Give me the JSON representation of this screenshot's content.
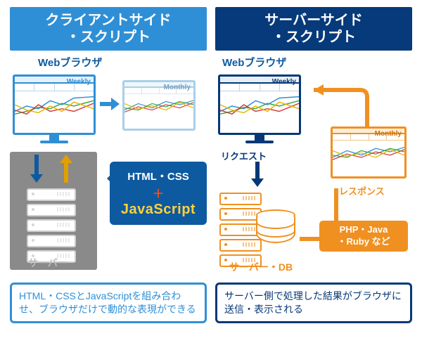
{
  "left": {
    "title_l1": "クライアントサイド",
    "title_l2": "・スクリプト",
    "browser_label": "Webブラウザ",
    "chart_left_tag": "Weekly",
    "chart_right_tag": "Monthly",
    "bubble_l1": "HTML・CSS",
    "bubble_plus": "＋",
    "bubble_js": "JavaScript",
    "server_label": "サーバー",
    "caption": "HTML・CSSとJavaScriptを組み合わせ、ブラウザだけで動的な表現ができる",
    "colors": {
      "accent": "#2f8fd6",
      "dark": "#0e5aa0",
      "js": "#ffd13a",
      "plus": "#ff4d17",
      "gray": "#8a8a8a"
    }
  },
  "right": {
    "title_l1": "サーバーサイド",
    "title_l2": "・スクリプト",
    "browser_label": "Webブラウザ",
    "chart_left_tag": "Weekly",
    "chart_right_tag": "Monthly",
    "request_label": "リクエスト",
    "response_label": "レスポンス",
    "tech_l1": "PHP・Java",
    "tech_l2": "・Ruby など",
    "server_label": "サーバー・DB",
    "caption": "サーバー側で処理した結果がブラウザに送信・表示される",
    "colors": {
      "accent": "#063877",
      "orange": "#f09020"
    }
  }
}
